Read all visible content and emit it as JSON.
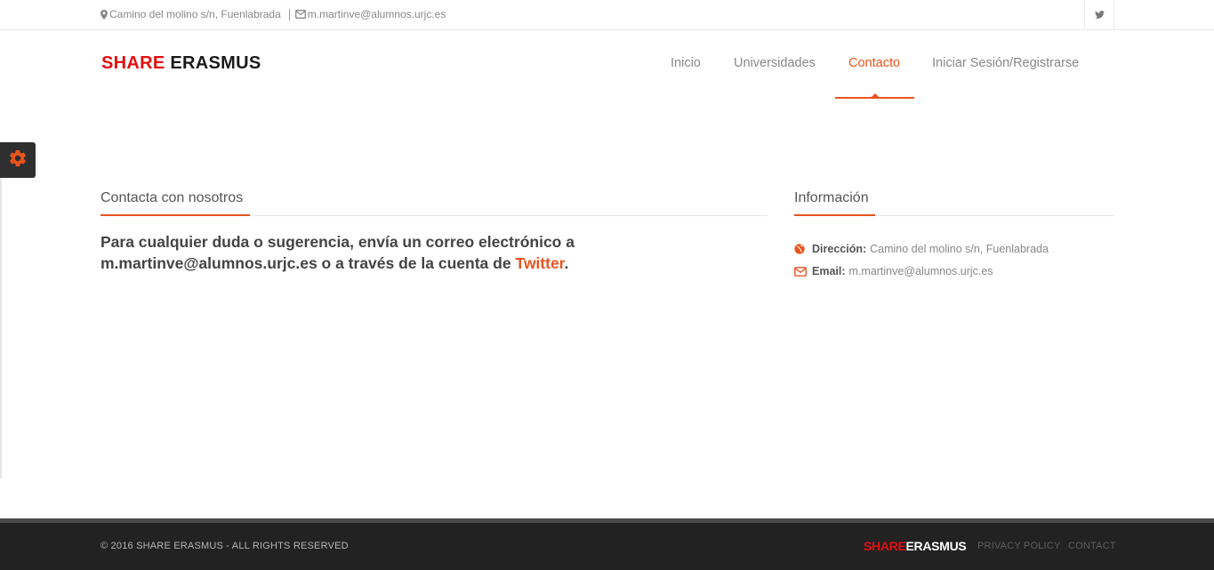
{
  "topbar": {
    "address": "Camino del molino s/n, Fuenlabrada",
    "email": "m.martinve@alumnos.urjc.es",
    "icons": {
      "address": "map-marker-icon",
      "email": "envelope-icon",
      "social": "twitter-icon"
    }
  },
  "logo": {
    "share": "SHARE",
    "erasmus": "ERASMUS"
  },
  "nav": {
    "items": [
      {
        "label": "Inicio",
        "active": false
      },
      {
        "label": "Universidades",
        "active": false
      },
      {
        "label": "Contacto",
        "active": true
      },
      {
        "label": "Iniciar Sesión/Registrarse",
        "active": false
      }
    ]
  },
  "settings": {
    "icon": "gear-icon"
  },
  "contact": {
    "title": "Contacta con nosotros",
    "message_before": "Para cualquier duda o sugerencia, envía un correo electrónico a m.martinve@alumnos.urjc.es o a través de la cuenta de ",
    "message_link": "Twitter",
    "message_after": "."
  },
  "info": {
    "title": "Información",
    "address_label": "Dirección:",
    "address_value": "Camino del molino s/n, Fuenlabrada",
    "email_label": "Email:",
    "email_value": "m.martinve@alumnos.urjc.es",
    "icons": {
      "address": "globe-icon",
      "email": "envelope-icon"
    }
  },
  "footer": {
    "copyright": "© 2016 SHARE ERASMUS - ALL RIGHTS RESERVED",
    "logo_share": "SHARE",
    "logo_erasmus": "ERASMUS",
    "links": [
      "PRIVACY POLICY",
      "CONTACT"
    ]
  },
  "colors": {
    "accent": "#e8541e",
    "brand_red": "#e10f12",
    "footer_bg": "#222222",
    "gear_tab_bg": "#2f2f2f"
  }
}
